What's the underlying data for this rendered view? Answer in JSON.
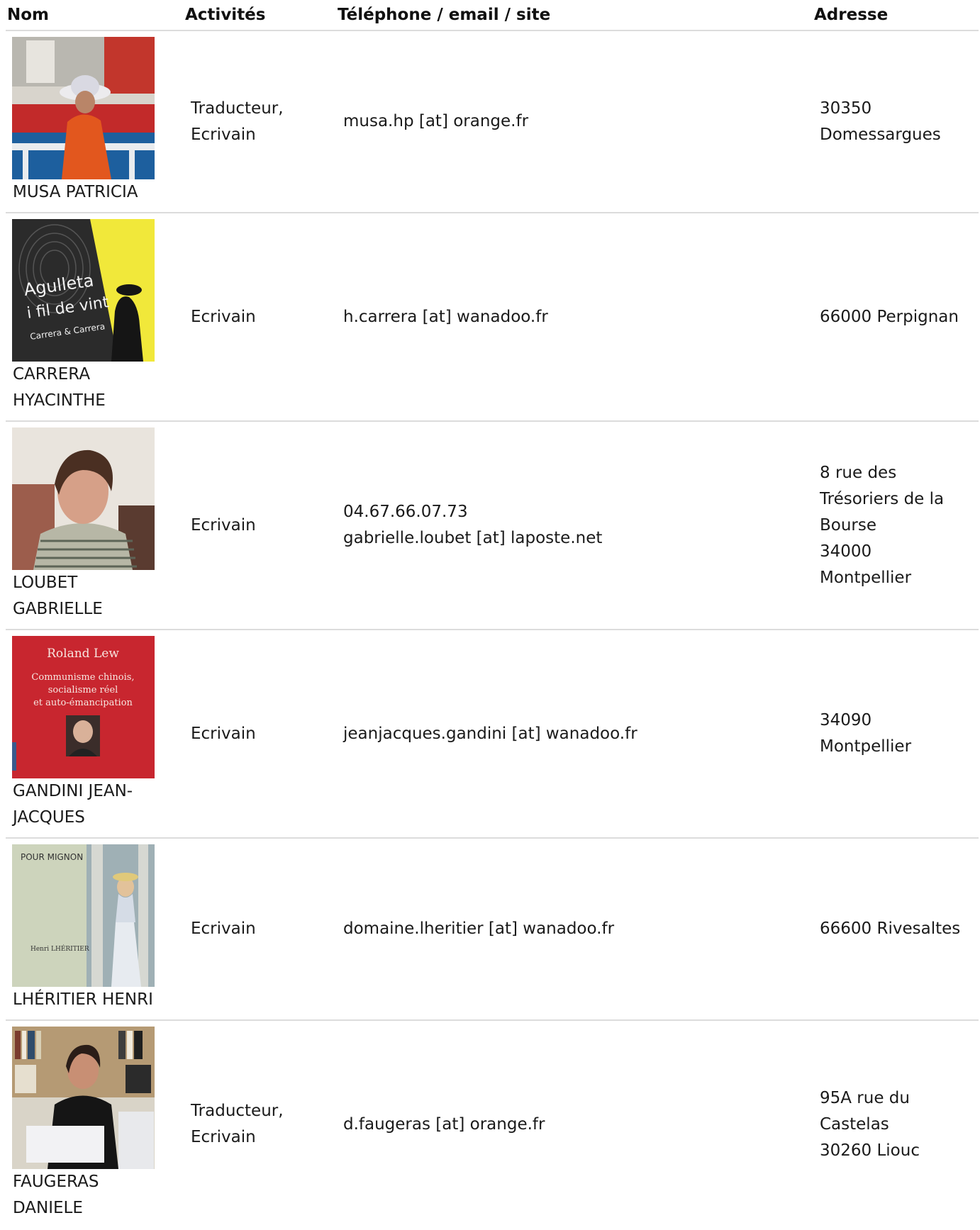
{
  "columns": {
    "name": "Nom",
    "activities": "Activités",
    "contact": "Téléphone / email / site",
    "address": "Adresse"
  },
  "rows": [
    {
      "name_lines": [
        "MUSA PATRICIA"
      ],
      "photo": "portrait-woman-hat-orange-photo",
      "activity_lines": [
        "Traducteur,",
        "Ecrivain"
      ],
      "contact_lines": [
        "musa.hp [at] orange.fr"
      ],
      "address_lines": [
        "30350",
        "Domessargues"
      ]
    },
    {
      "name_lines": [
        "CARRERA",
        "HYACINTHE"
      ],
      "photo": "book-cover-agulleta-photo",
      "cover_text": [
        "Agulleta",
        "i fil de vint",
        "Carrera & Carrera"
      ],
      "activity_lines": [
        "Ecrivain"
      ],
      "contact_lines": [
        "h.carrera [at] wanadoo.fr"
      ],
      "address_lines": [
        "66000 Perpignan"
      ]
    },
    {
      "name_lines": [
        "LOUBET",
        "GABRIELLE"
      ],
      "photo": "portrait-woman-striped-shirt-photo",
      "activity_lines": [
        "Ecrivain"
      ],
      "contact_lines": [
        "04.67.66.07.73",
        "gabrielle.loubet [at] laposte.net"
      ],
      "address_lines": [
        "8 rue des",
        "Trésoriers de la",
        "Bourse",
        "34000",
        "Montpellier"
      ]
    },
    {
      "name_lines": [
        "GANDINI JEAN-",
        "JACQUES"
      ],
      "photo": "book-cover-communisme-chinois-photo",
      "cover_text": [
        "Roland Lew",
        "Communisme chinois,",
        "socialisme réel",
        "et auto-émancipation"
      ],
      "activity_lines": [
        "Ecrivain"
      ],
      "contact_lines": [
        "jeanjacques.gandini [at] wanadoo.fr"
      ],
      "address_lines": [
        "34090",
        "Montpellier"
      ]
    },
    {
      "name_lines": [
        "LHÉRITIER HENRI"
      ],
      "photo": "book-cover-pour-mignon-photo",
      "cover_text": [
        "POUR MIGNON",
        "Henri LHÉRITIER"
      ],
      "activity_lines": [
        "Ecrivain"
      ],
      "contact_lines": [
        "domaine.lheritier [at] wanadoo.fr"
      ],
      "address_lines": [
        "66600 Rivesaltes"
      ]
    },
    {
      "name_lines": [
        "FAUGERAS",
        "DANIELE"
      ],
      "photo": "portrait-woman-bookshelf-photo",
      "activity_lines": [
        "Traducteur,",
        "Ecrivain"
      ],
      "contact_lines": [
        "d.faugeras [at] orange.fr"
      ],
      "address_lines": [
        "95A rue du",
        "Castelas",
        "30260 Liouc"
      ]
    }
  ]
}
